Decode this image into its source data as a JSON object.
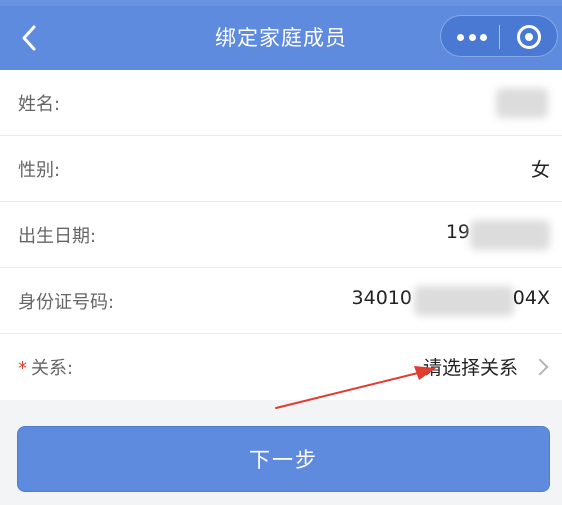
{
  "header": {
    "title": "绑定家庭成员",
    "back_icon": "chevron-left-icon",
    "more_icon": "more-dots-icon",
    "close_icon": "target-circle-icon"
  },
  "form": {
    "rows": [
      {
        "label": "姓名:",
        "value": ""
      },
      {
        "label": "性别:",
        "value": "女"
      },
      {
        "label": "出生日期:",
        "value": "19"
      },
      {
        "label": "身份证号码:",
        "value_start": "34010",
        "value_end": "04X"
      },
      {
        "required_mark": "*",
        "label": "关系:",
        "placeholder": "请选择关系"
      }
    ]
  },
  "footer": {
    "next_label": "下一步"
  },
  "colors": {
    "primary": "#5e8bde",
    "annotation_arrow": "#e23b30",
    "required": "#e43c2f"
  }
}
